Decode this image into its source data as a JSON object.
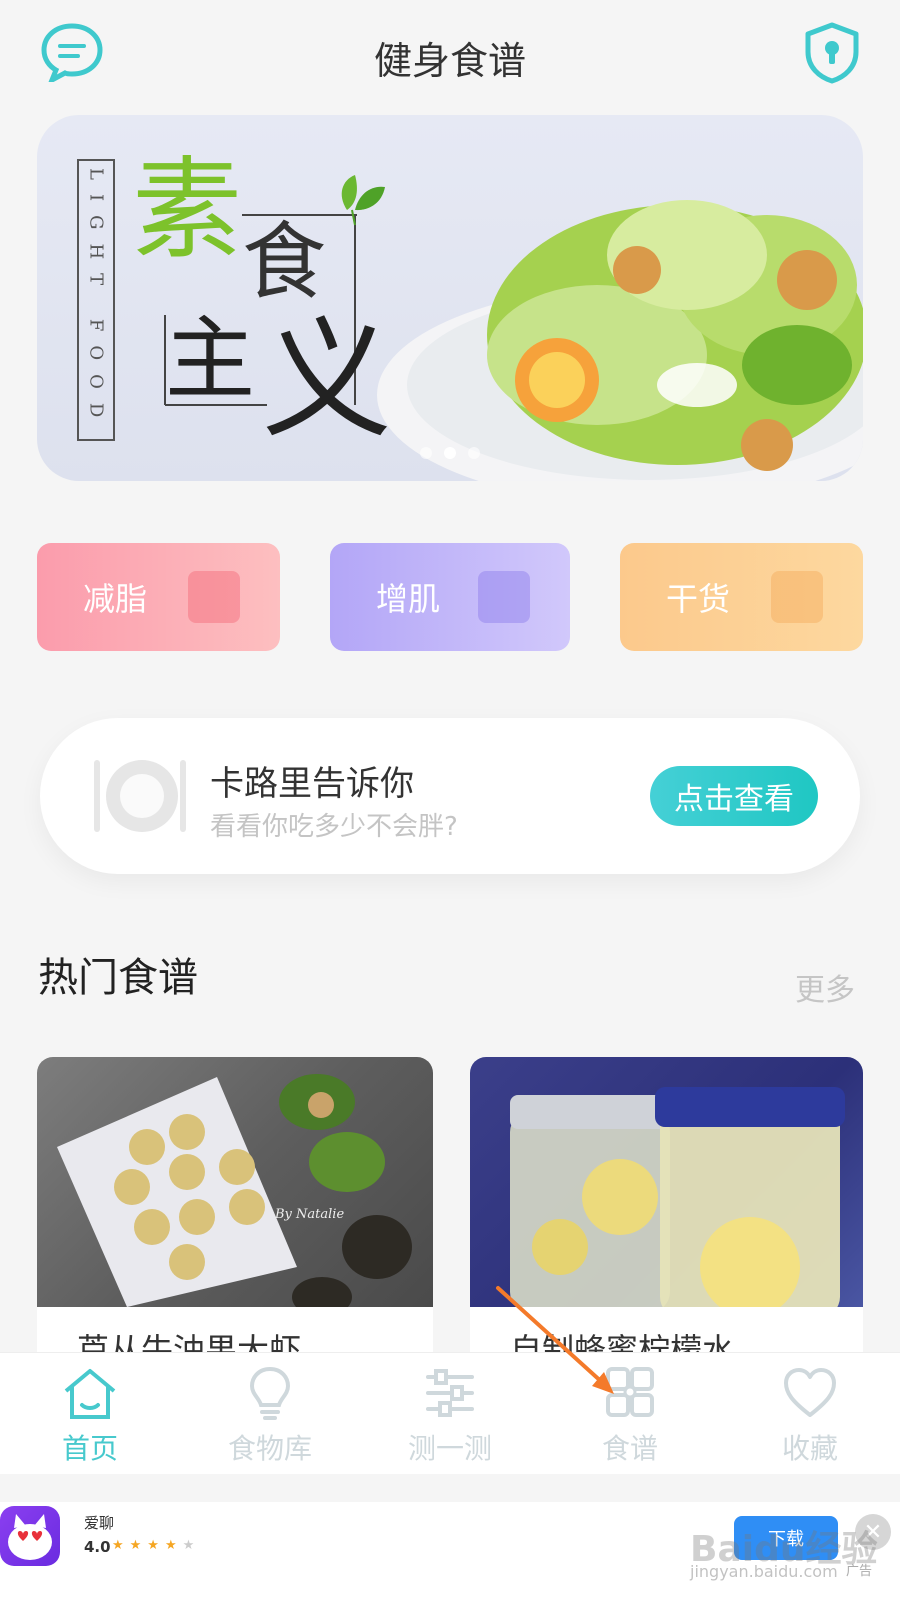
{
  "header": {
    "title": "健身食谱"
  },
  "banner": {
    "vertical_text": "LIGHT FOOD",
    "title_chars": [
      "素",
      "食",
      "主",
      "义"
    ]
  },
  "categories": [
    {
      "label": "减脂",
      "icon": "scale-icon"
    },
    {
      "label": "增肌",
      "icon": "dumbbell-icon"
    },
    {
      "label": "干货",
      "icon": "clipboard-icon"
    }
  ],
  "calorie_card": {
    "title": "卡路里告诉你",
    "subtitle": "看看你吃多少不会胖?",
    "button_label": "点击查看"
  },
  "hot_recipes": {
    "title": "热门食谱",
    "more_label": "更多",
    "items": [
      {
        "title": "芦从牛油果大虾",
        "photo_watermark": "By Natalie"
      },
      {
        "title": "自制蜂蜜柠檬水"
      }
    ]
  },
  "bottom_nav": {
    "active": "首页",
    "items": [
      {
        "label": "首页",
        "icon": "home-icon"
      },
      {
        "label": "食物库",
        "icon": "bulb-icon"
      },
      {
        "label": "测一测",
        "icon": "sliders-icon"
      },
      {
        "label": "食谱",
        "icon": "grid-icon"
      },
      {
        "label": "收藏",
        "icon": "heart-icon"
      }
    ]
  },
  "ad": {
    "app_name": "爱聊",
    "rating": "4.0",
    "stars_filled": 4,
    "stars_total": 5,
    "button_label": "下载",
    "tag": "广告"
  },
  "watermark": {
    "brand": "Baidu经验",
    "url": "jingyan.baidu.com"
  },
  "colors": {
    "accent": "#47c9cd",
    "fat": "#fb9cac",
    "muscle": "#b3a6f7",
    "dry": "#fcc98c",
    "annotation_arrow": "#f47a2a"
  }
}
